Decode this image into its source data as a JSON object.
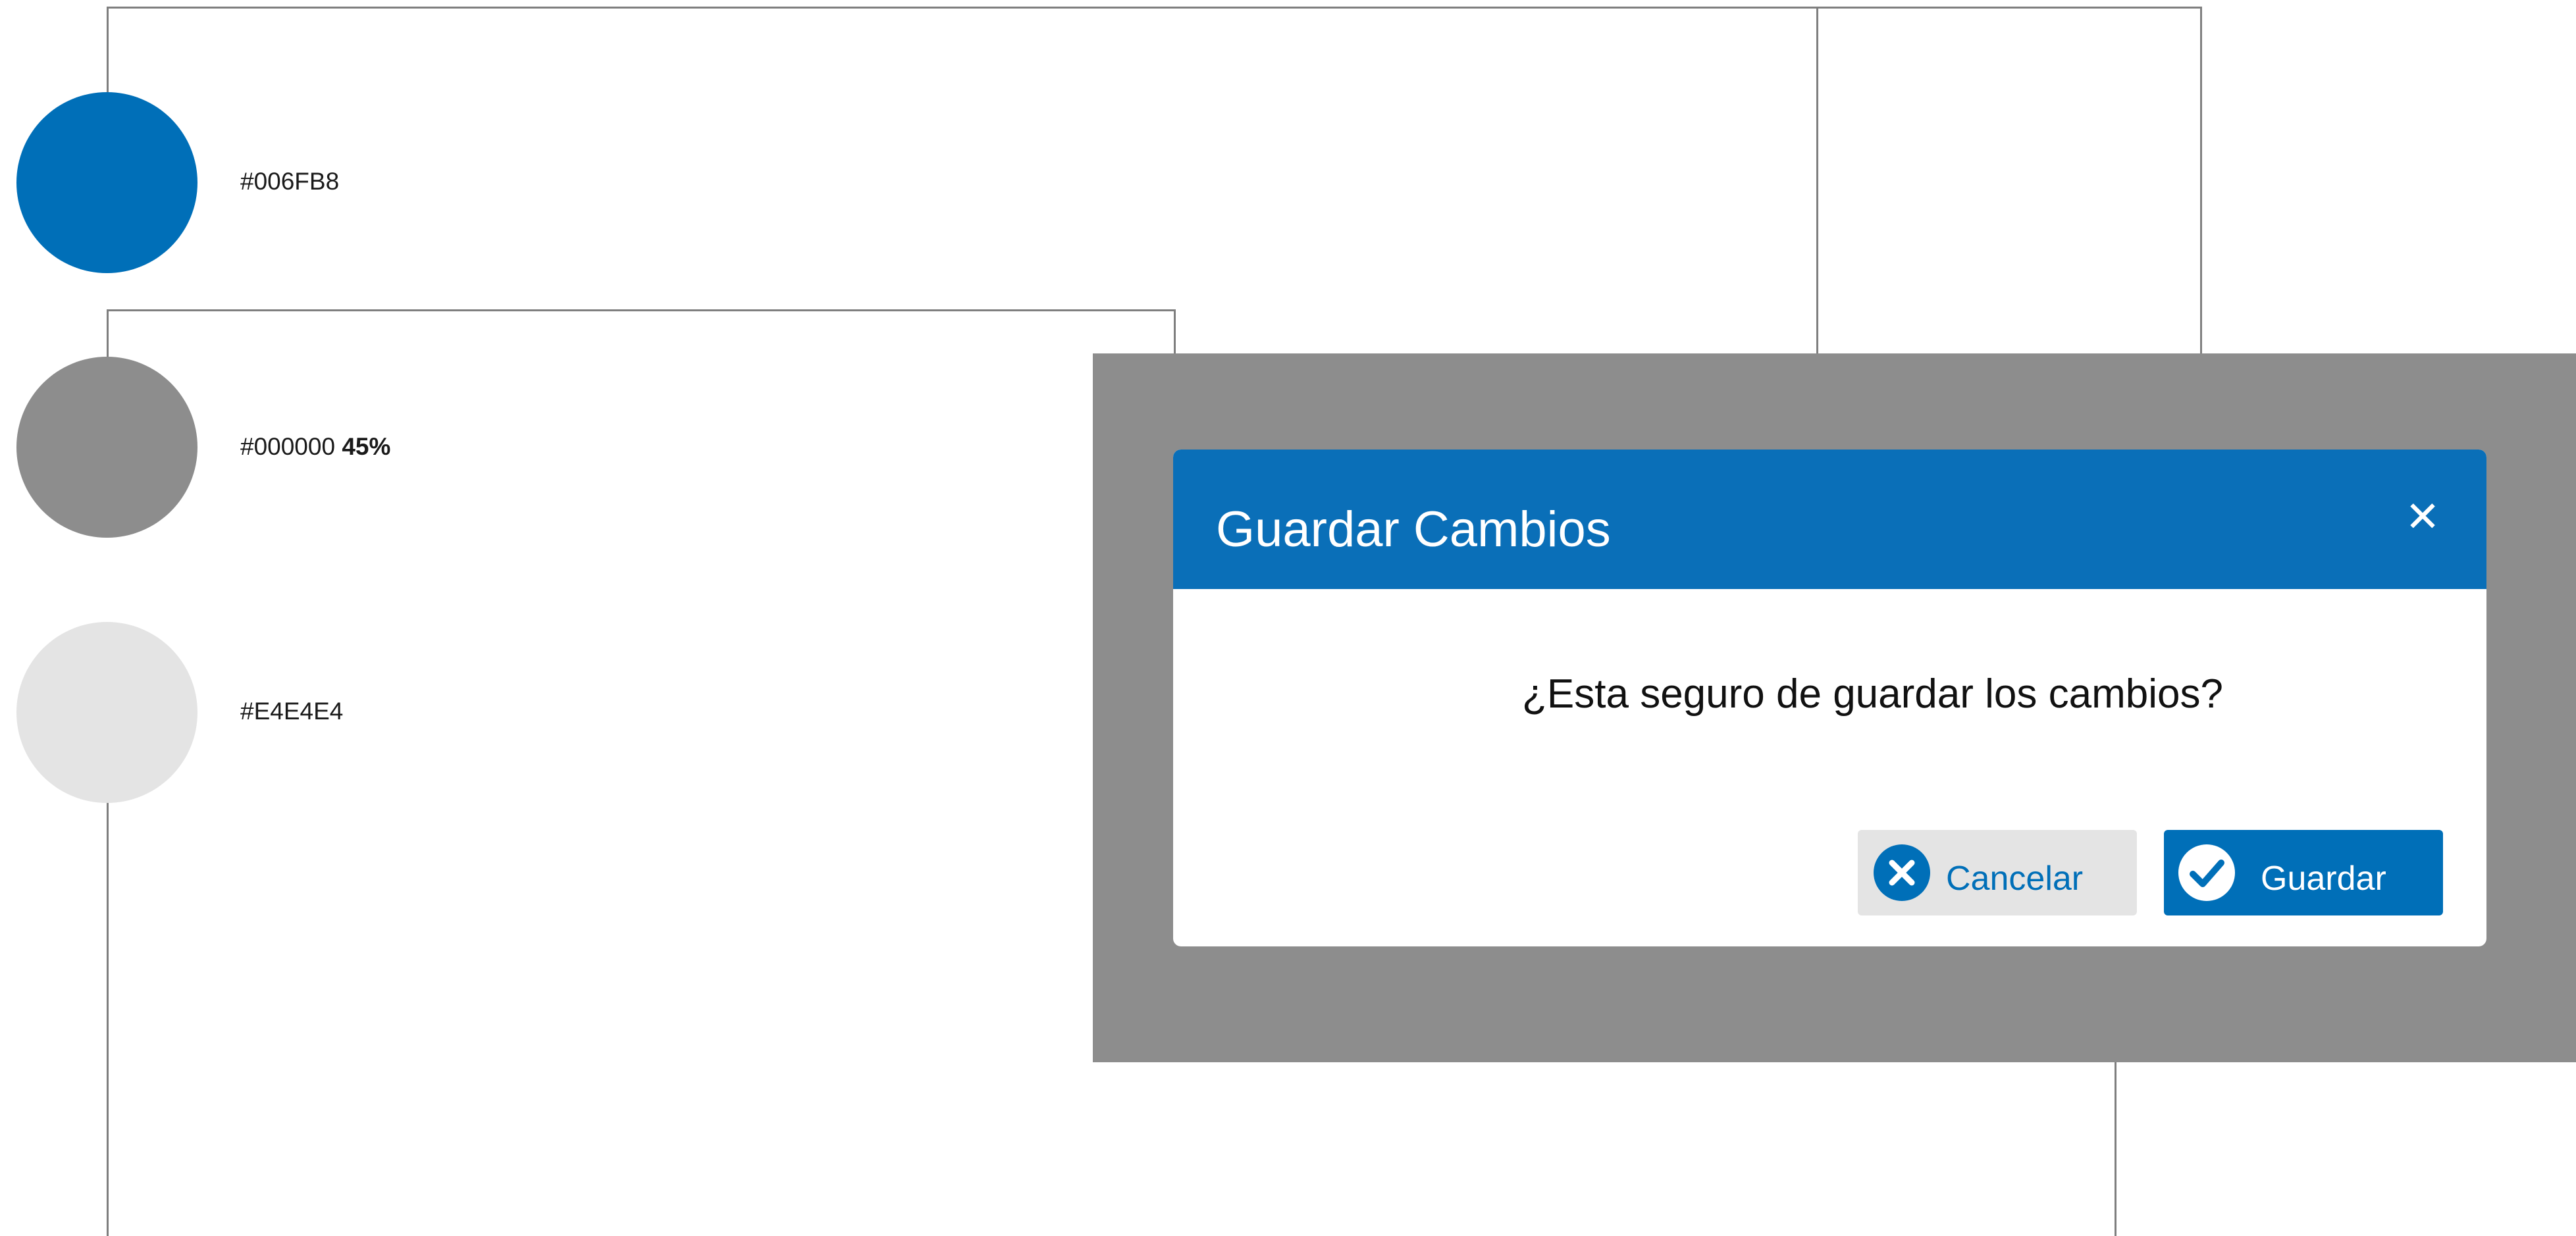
{
  "colors": {
    "primary": "#006FB8",
    "overlay": "#8D8D8D",
    "secondary": "#E4E4E4",
    "header": "#0A6FB8"
  },
  "swatches": [
    {
      "hex": "#006FB8",
      "label": "#006FB8"
    },
    {
      "hex": "#8D8D8D",
      "label": "#000000",
      "opacity_label": "45%"
    },
    {
      "hex": "#E4E4E4",
      "label": "#E4E4E4"
    }
  ],
  "dialog": {
    "title": "Guardar Cambios",
    "close_icon": "close-icon",
    "message": "¿Esta seguro de guardar los cambios?",
    "cancel_label": "Cancelar",
    "cancel_icon": "x-circle-icon",
    "save_label": "Guardar",
    "save_icon": "check-circle-icon"
  }
}
